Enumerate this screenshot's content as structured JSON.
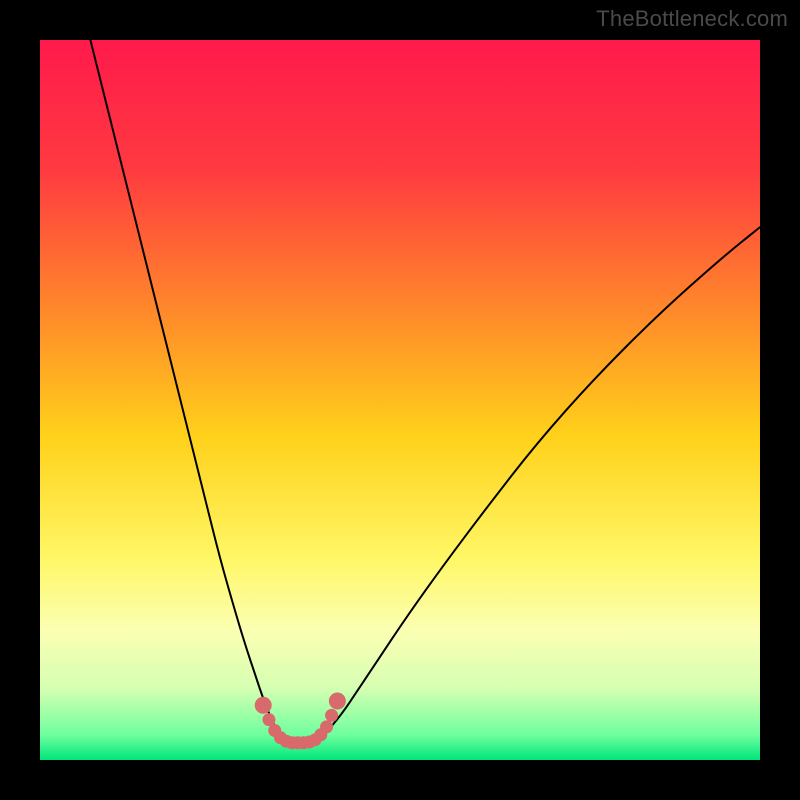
{
  "watermark_text": "TheBottleneck.com",
  "chart_data": {
    "type": "line",
    "title": "",
    "xlabel": "",
    "ylabel": "",
    "xlim": [
      0,
      100
    ],
    "ylim": [
      0,
      100
    ],
    "grid": false,
    "legend": false,
    "background_gradient": {
      "stops": [
        {
          "offset": 0.0,
          "color": "#ff1a4b"
        },
        {
          "offset": 0.18,
          "color": "#ff3a40"
        },
        {
          "offset": 0.38,
          "color": "#ff8a2a"
        },
        {
          "offset": 0.55,
          "color": "#ffd11a"
        },
        {
          "offset": 0.72,
          "color": "#fff766"
        },
        {
          "offset": 0.82,
          "color": "#fbffb2"
        },
        {
          "offset": 0.9,
          "color": "#d6ffb2"
        },
        {
          "offset": 0.965,
          "color": "#6fff9e"
        },
        {
          "offset": 1.0,
          "color": "#00e67a"
        }
      ]
    },
    "series": [
      {
        "name": "left-curve",
        "stroke": "#000000",
        "stroke_width": 2,
        "x": [
          7,
          9,
          11,
          13,
          15,
          17,
          19,
          21,
          23,
          25,
          27,
          28.5,
          30,
          31,
          32,
          32.6
        ],
        "y": [
          100,
          92,
          84,
          76,
          68,
          60,
          52,
          44,
          36,
          28,
          21,
          16,
          11.5,
          8.5,
          6,
          4.7
        ]
      },
      {
        "name": "right-curve",
        "stroke": "#000000",
        "stroke_width": 2,
        "x": [
          40.5,
          42,
          44,
          47,
          51,
          56,
          62,
          69,
          77,
          86,
          95,
          100
        ],
        "y": [
          4.7,
          6.5,
          9.5,
          14,
          20,
          27,
          35,
          44,
          53,
          62,
          70,
          74
        ]
      },
      {
        "name": "trough-band",
        "type": "dot-band",
        "color": "#d86a6c",
        "dot_radius": 6.5,
        "endpoint_radius": 8.5,
        "x": [
          31.0,
          31.8,
          32.6,
          33.4,
          34.2,
          35.0,
          35.8,
          36.6,
          37.4,
          38.2,
          39.0,
          39.8,
          40.5,
          41.3
        ],
        "y": [
          7.6,
          5.6,
          4.1,
          3.1,
          2.6,
          2.4,
          2.4,
          2.4,
          2.5,
          2.8,
          3.5,
          4.6,
          6.2,
          8.2
        ]
      }
    ],
    "annotations": []
  }
}
